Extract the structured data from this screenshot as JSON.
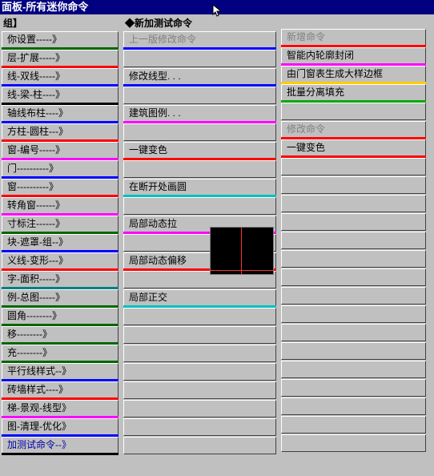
{
  "title": "面板-所有迷你命令",
  "left": {
    "header": "组】",
    "items": [
      {
        "label": "你设置-----》",
        "color": "#006600"
      },
      {
        "label": "层-扩展-----》",
        "color": "#ff0000"
      },
      {
        "label": "线-双线-----》",
        "color": "#0000ff"
      },
      {
        "label": "线-梁-柱----》",
        "color": "#000000"
      },
      {
        "label": "轴线布柱----》",
        "color": "#0000ff"
      },
      {
        "label": "方柱-圆柱---》",
        "color": "#ff0000"
      },
      {
        "label": "窗-编号-----》",
        "color": "#ff00ff"
      },
      {
        "label": "门----------》",
        "color": "#0000ff"
      },
      {
        "label": "窗----------》",
        "color": "#ff0000"
      },
      {
        "label": "转角窗------》",
        "color": "#ff00ff"
      },
      {
        "label": "寸标注------》",
        "color": "#006600"
      },
      {
        "label": "块-遮罩-组--》",
        "color": "#0000ff"
      },
      {
        "label": "义线-变形---》",
        "color": "#ff0000"
      },
      {
        "label": "字-面积-----》",
        "color": "#008080"
      },
      {
        "label": "例-总图-----》",
        "color": "#006600"
      },
      {
        "label": "圆角--------》",
        "color": "#006600"
      },
      {
        "label": "  移--------》",
        "color": "#006600"
      },
      {
        "label": "  充--------》",
        "color": "#006600"
      },
      {
        "label": "平行线样式--》",
        "color": "#0000ff"
      },
      {
        "label": "砖墙样式----》",
        "color": "#ff0000"
      },
      {
        "label": "梯-景观-线型》",
        "color": "#ff00ff"
      },
      {
        "label": "图-清理-优化》",
        "color": "#0000ff"
      },
      {
        "label": "加测试命令--》",
        "color": "#000000",
        "textColor": "#0000aa"
      }
    ]
  },
  "mid": {
    "header": "◆新加测试命令",
    "items": [
      {
        "label": "上一版修改命令",
        "color": "#0000ff",
        "dim": true
      },
      {
        "label": "",
        "color": "transparent"
      },
      {
        "label": "修改线型. . .",
        "color": "#0000ff"
      },
      {
        "label": "",
        "color": "transparent"
      },
      {
        "label": "建筑图例. . .",
        "color": "#ff00ff"
      },
      {
        "label": "",
        "color": "transparent"
      },
      {
        "label": "一键变色",
        "color": "#ff0000"
      },
      {
        "label": "",
        "color": "transparent"
      },
      {
        "label": "在断开处画圆",
        "color": "#00c0c0"
      },
      {
        "label": "",
        "color": "transparent"
      },
      {
        "label": "局部动态拉",
        "color": "#ff00ff"
      },
      {
        "label": "",
        "color": "transparent"
      },
      {
        "label": "局部动态偏移",
        "color": "#ff0000"
      },
      {
        "label": "",
        "color": "transparent"
      },
      {
        "label": "局部正交",
        "color": "#00c0c0"
      },
      {
        "label": "",
        "color": "transparent"
      },
      {
        "label": "",
        "color": "transparent"
      },
      {
        "label": "",
        "color": "transparent"
      },
      {
        "label": "",
        "color": "transparent"
      },
      {
        "label": "",
        "color": "transparent"
      },
      {
        "label": "",
        "color": "transparent"
      },
      {
        "label": "",
        "color": "transparent"
      },
      {
        "label": "",
        "color": "transparent"
      }
    ]
  },
  "right": {
    "items": [
      {
        "label": "新增命令",
        "color": "#ff0000",
        "dim": true
      },
      {
        "label": "智能内轮廓封闭",
        "color": "#ff00ff"
      },
      {
        "label": "由门窗表生成大样边框",
        "color": "#ffcc00"
      },
      {
        "label": "批量分离填充",
        "color": "#00aa00"
      },
      {
        "label": "",
        "color": "transparent"
      },
      {
        "label": "修改命令",
        "color": "#ff0000",
        "dim": true
      },
      {
        "label": "一键变色",
        "color": "#ff0000"
      },
      {
        "label": "",
        "color": "transparent"
      },
      {
        "label": "",
        "color": "transparent"
      },
      {
        "label": "",
        "color": "transparent"
      },
      {
        "label": "",
        "color": "transparent"
      },
      {
        "label": "",
        "color": "transparent"
      },
      {
        "label": "",
        "color": "transparent"
      },
      {
        "label": "",
        "color": "transparent"
      },
      {
        "label": "",
        "color": "transparent"
      },
      {
        "label": "",
        "color": "transparent"
      },
      {
        "label": "",
        "color": "transparent"
      },
      {
        "label": "",
        "color": "transparent"
      },
      {
        "label": "",
        "color": "transparent"
      },
      {
        "label": "",
        "color": "transparent"
      },
      {
        "label": "",
        "color": "transparent"
      },
      {
        "label": "",
        "color": "transparent"
      },
      {
        "label": "",
        "color": "transparent"
      }
    ]
  }
}
